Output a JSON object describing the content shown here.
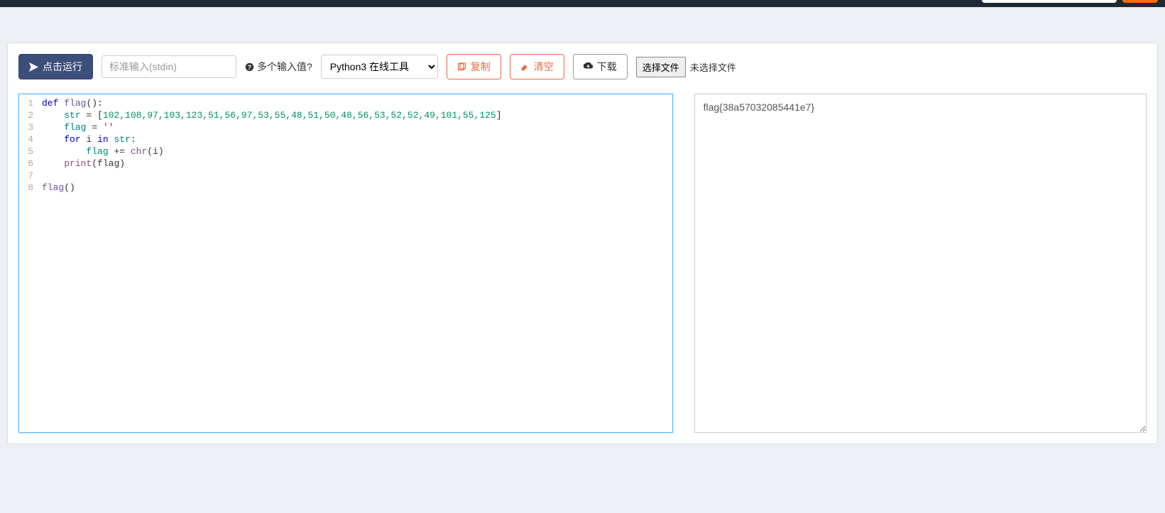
{
  "toolbar": {
    "run_label": "点击运行",
    "stdin_placeholder": "标准输入(stdin)",
    "multi_input_label": "多个输入值?",
    "lang_selected": "Python3 在线工具",
    "copy_label": "复制",
    "clear_label": "清空",
    "download_label": "下载",
    "file_choose_label": "选择文件",
    "file_none_label": "未选择文件"
  },
  "editor": {
    "line_numbers": [
      "1",
      "2",
      "3",
      "4",
      "5",
      "6",
      "7",
      "8"
    ],
    "code_plain": "def flag():\n    str = [102,108,97,103,123,51,56,97,53,55,48,51,50,48,56,53,52,52,49,101,55,125]\n    flag = ''\n    for i in str:\n        flag += chr(i)\n    print(flag)\n\nflag()",
    "tokens": {
      "l1": {
        "kw_def": "def",
        "fn": "flag",
        "rest": "():"
      },
      "l2": {
        "indent": "    ",
        "id": "str",
        "eq": " = [",
        "nums": "102,108,97,103,123,51,56,97,53,55,48,51,50,48,56,53,52,52,49,101,55,125",
        "close": "]"
      },
      "l3": {
        "indent": "    ",
        "id": "flag",
        "eq": " = ",
        "str": "''"
      },
      "l4": {
        "indent": "    ",
        "kw_for": "for",
        "sp1": " ",
        "var": "i",
        "sp2": " ",
        "kw_in": "in",
        "sp3": " ",
        "id": "str",
        "colon": ":"
      },
      "l5": {
        "indent": "        ",
        "id": "flag",
        "op": " += ",
        "builtin": "chr",
        "open": "(",
        "arg": "i",
        "close": ")"
      },
      "l6": {
        "indent": "    ",
        "builtin": "print",
        "open": "(",
        "arg": "flag",
        "close": ")"
      },
      "l8": {
        "fn": "flag",
        "call": "()"
      }
    }
  },
  "output": {
    "text": "flag{38a57032085441e7}"
  }
}
